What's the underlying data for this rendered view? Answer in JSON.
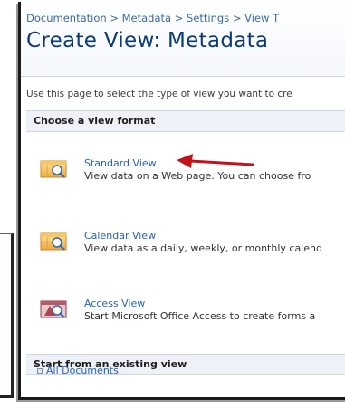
{
  "breadcrumb": {
    "items": [
      "Documentation",
      "Metadata",
      "Settings",
      "View T"
    ],
    "separator": ">"
  },
  "page_title": "Create View: Metadata",
  "intro_text": "Use this page to select the type of view you want to cre",
  "sections": {
    "format": {
      "heading": "Choose a view format"
    },
    "existing": {
      "heading": "Start from an existing view"
    }
  },
  "views": [
    {
      "label": "Standard View",
      "description": "View data on a Web page. You can choose fro",
      "icon": "standard-view-icon"
    },
    {
      "label": "Calendar View",
      "description": "View data as a daily, weekly, or monthly calend",
      "icon": "calendar-view-icon"
    },
    {
      "label": "Access View",
      "description": "Start Microsoft Office Access to create forms a",
      "icon": "access-view-icon"
    }
  ],
  "existing_views": [
    {
      "label": "All Documents"
    }
  ],
  "colors": {
    "link": "#2b63b0",
    "title": "#0b3a75",
    "arrow": "#c0141b"
  }
}
